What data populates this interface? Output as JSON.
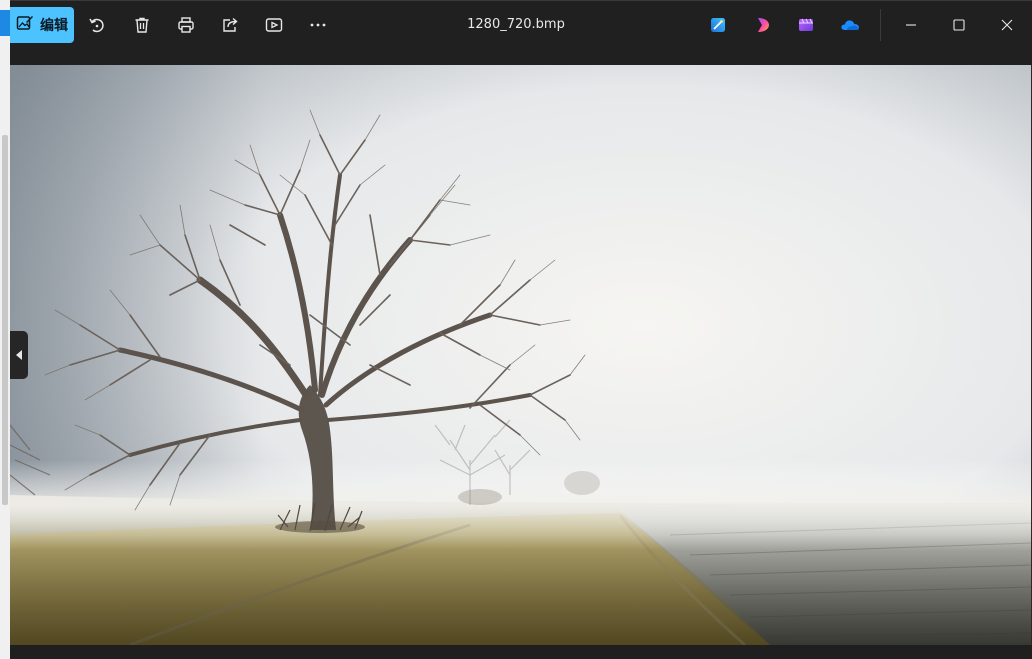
{
  "toolbar": {
    "edit_label": "编辑",
    "file_name": "1280_720.bmp"
  },
  "icons": {
    "edit": "edit-image-icon",
    "rotate": "rotate-icon",
    "delete": "trash-icon",
    "print": "print-icon",
    "share": "share-icon",
    "slideshow": "slideshow-icon",
    "more": "more-icon",
    "designer": "designer-icon",
    "clipchamp_create": "clipchamp-icon",
    "clipchamp_video": "video-editor-icon",
    "onedrive": "onedrive-icon",
    "minimize": "minimize-icon",
    "maximize": "maximize-icon",
    "close": "close-icon",
    "prev": "previous-image-icon"
  },
  "colors": {
    "accent": "#4cc2ff",
    "titlebar": "#202020"
  }
}
